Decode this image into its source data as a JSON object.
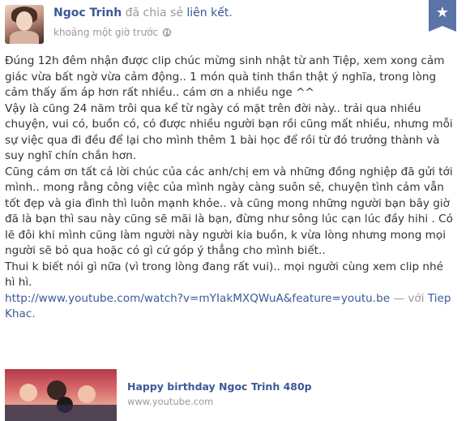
{
  "post": {
    "author_name": "Ngoc Trinh",
    "shared_verb": " đã chia sẻ ",
    "shared_object": "liên kết.",
    "timestamp": "khoảng một giờ trước",
    "privacy_icon": "globe-icon",
    "badge_icon": "star-icon",
    "body_lines": [
      "Đúng 12h đêm nhận được clip chúc mừng sinh nhật từ anh Tiệp, xem xong cảm",
      "giác vừa bất ngờ vừa cảm động.. 1 món quà tinh thần thật ý nghĩa, trong lòng",
      "cảm thấy ấm áp hơn rất nhiều.. cám ơn a nhiều nge ^^",
      "Vậy là cũng 24 năm trôi qua kể từ ngày có mặt trên đời này.. trải qua nhiều",
      "chuyện, vui có, buồn có, có được nhiều người bạn rồi cũng mất nhiều, nhưng mỗi",
      "sự việc qua đi đều để lại cho mình thêm 1 bài học để rồi từ đó trưởng thành và",
      "suy nghĩ chín chắn hơn.",
      "Cũng cám ơn tất cả lời chúc của các anh/chị em và những đồng nghiệp đã gửi tới",
      "mình.. mong rằng công việc của mình ngày càng suôn sẻ, chuyện tình cảm vẫn",
      "tốt đẹp và gia đình thì luôn mạnh khỏe.. và cũng mong những người bạn bây giờ",
      "đã là bạn thì sau này cũng sẽ mãi là bạn, đừng như sông lúc cạn lúc đầy hihi . Có",
      "lẽ đôi khi mình cũng làm người này người kia buồn, k vừa lòng nhưng mong mọi",
      "người sẽ bỏ qua hoặc có gì cứ góp ý thẳng cho mình biết..",
      "Thui k biết nói gì nữa (vì trong lòng đang rất vui).. mọi người cùng xem clip nhé",
      "hì hì."
    ],
    "link_url": "http://www.youtube.com/watch?v=mYIakMXQWuA&feature=youtu.be",
    "with_separator": " — với ",
    "tagged_first": "Tiep",
    "tagged_second": "Khac."
  },
  "video_card": {
    "title": "Happy birthday Ngoc Trinh 480p",
    "domain": "www.youtube.com"
  },
  "colors": {
    "link_blue": "#3b5998",
    "meta_gray": "#999999",
    "badge_bg": "#5b74a8",
    "text": "#333333"
  }
}
